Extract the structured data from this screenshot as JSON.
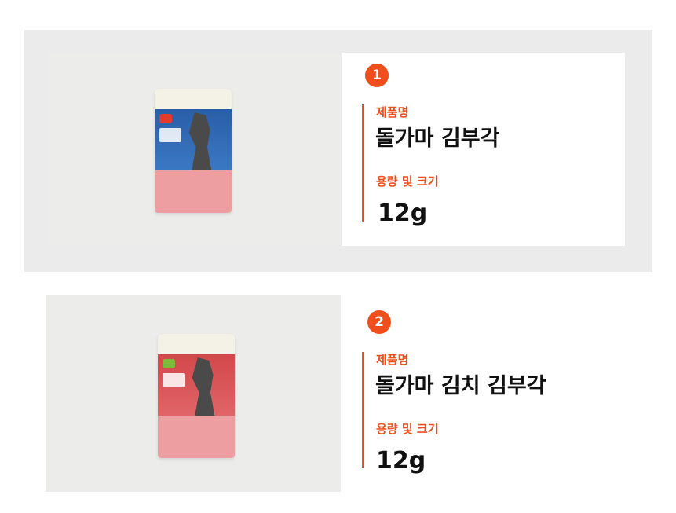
{
  "items": [
    {
      "number": "1",
      "name_label": "제품명",
      "name": "돌가마 김부각",
      "size_label": "용량 및 크기",
      "size": "12g",
      "image": "kim-bugak-package-blue"
    },
    {
      "number": "2",
      "name_label": "제품명",
      "name": "돌가마 김치 김부각",
      "size_label": "용량 및 크기",
      "size": "12g",
      "image": "kimchi-kim-bugak-package-red"
    }
  ],
  "colors": {
    "accent": "#f04e1c",
    "panel_background": "#ebebeb",
    "text": "#111111"
  }
}
